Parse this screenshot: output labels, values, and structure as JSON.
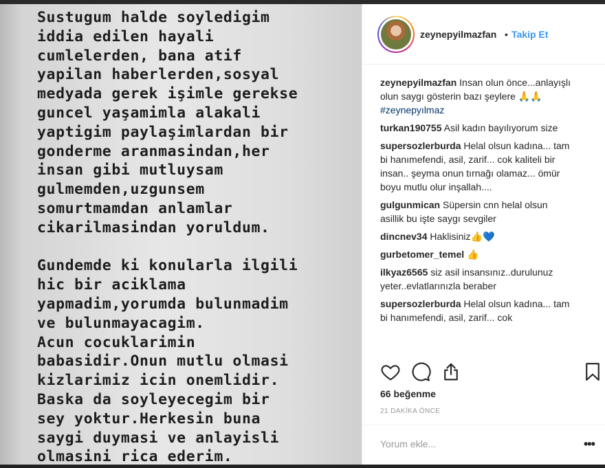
{
  "post": {
    "text": "Sustugum halde soyledigim\niddia edilen hayali\ncumlelerden, bana atif\nyapilan haberlerden,sosyal\nmedyada gerek işimle gerekse\nguncel yaşamimla alakali\nyaptigim paylaşimlardan bir\ngonderme aranmasindan,her\ninsan gibi mutluysam\ngulmemden,uzgunsem\nsomurtmamdan anlamlar\ncikarilmasindan yoruldum.\n\nGundemde ki konularla ilgili\nhic bir aciklama\nyapmadim,yorumda bulunmadim\nve bulunmayacagim.\nAcun cocuklarimin\nbabasidir.Onun mutlu olmasi\nkizlarimiz icin onemlidir.\nBaska da soyleyecegim bir\nsey yoktur.Herkesin buna\nsaygi duymasi ve anlayisli\nolmasini rica ederim."
  },
  "header": {
    "username": "zeynepyilmazfan",
    "separator": "•",
    "follow_label": "Takip Et"
  },
  "caption": {
    "user": "zeynepyilmazfan",
    "text": "Insan olun önce...anlayışlı olun saygı gösterin bazı şeylere 🙏🙏",
    "hashtag": "#zeynepyılmaz"
  },
  "comments": [
    {
      "user": "turkan190755",
      "text": "Asil kadın bayılıyorum size"
    },
    {
      "user": "supersozlerburda",
      "text": "Helal olsun kadına... tam bi hanımefendi, asil, zarif... cok kaliteli bir insan.. şeyma onun tırnağı olamaz... ömür boyu mutlu olur inşallah...."
    },
    {
      "user": "gulgunmican",
      "text": "Süpersin cnn helal olsun asillik bu işte saygı sevgiler"
    },
    {
      "user": "dincnev34",
      "text": "Haklisiniz",
      "emoji": "👍",
      "emoji2": "💙"
    },
    {
      "user": "gurbetomer_temel",
      "text": "",
      "emoji": "👍",
      "emoji2": ""
    },
    {
      "user": "ilkyaz6565",
      "text": "siz asil insansınız..durulunuz yeter..evlatlarınızla beraber"
    },
    {
      "user": "supersozlerburda",
      "text": "Helal olsun kadına... tam bi hanımefendi, asil, zarif... cok"
    }
  ],
  "likes_label": "66 beğenme",
  "time_label": "21 DAKİKA ÖNCE",
  "comment_input": {
    "placeholder": "Yorum ekle..."
  },
  "more_label": "•••",
  "icons": {
    "like": "heart-icon",
    "comment": "comment-icon",
    "share": "share-icon",
    "save": "bookmark-icon",
    "comment_like": "heart-icon"
  },
  "colors": {
    "follow": "#3897f0",
    "text": "#262626",
    "muted": "#999999"
  }
}
